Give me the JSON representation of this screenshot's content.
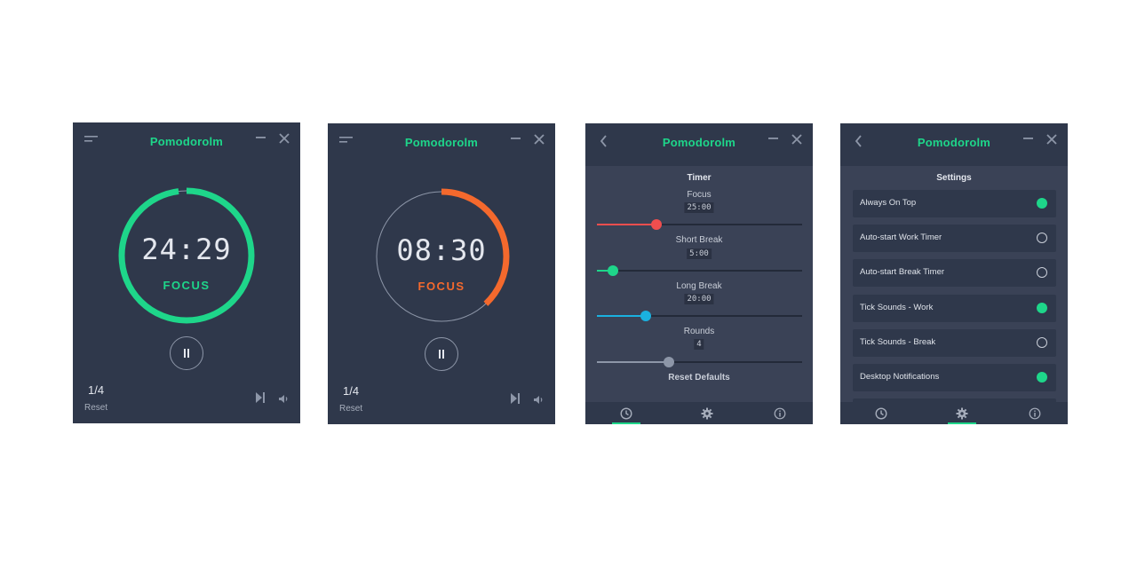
{
  "app": {
    "title": "Pomodorolm"
  },
  "colors": {
    "focus": "#1ed68a",
    "short_break": "#f4692d",
    "long_break": "#1ab1e0",
    "bg": "#2f384b",
    "panel": "#3a4256"
  },
  "timer_focus": {
    "time": "24:29",
    "mode": "FOCUS",
    "progress": 0.98,
    "round": "1/4",
    "reset_label": "Reset"
  },
  "timer_break": {
    "time": "08:30",
    "mode": "FOCUS",
    "progress": 0.38,
    "round": "1/4",
    "reset_label": "Reset"
  },
  "timer_settings": {
    "heading": "Timer",
    "sliders": [
      {
        "label": "Focus",
        "value": "25:00",
        "fraction": 0.29,
        "color": "#f04e4e"
      },
      {
        "label": "Short Break",
        "value": "5:00",
        "fraction": 0.08,
        "color": "#1ed68a"
      },
      {
        "label": "Long Break",
        "value": "20:00",
        "fraction": 0.24,
        "color": "#1ab1e0"
      },
      {
        "label": "Rounds",
        "value": "4",
        "fraction": 0.35,
        "color": "#8d96a8"
      }
    ],
    "reset_defaults": "Reset Defaults"
  },
  "settings": {
    "heading": "Settings",
    "options": [
      {
        "label": "Always On Top",
        "enabled": true
      },
      {
        "label": "Auto-start Work Timer",
        "enabled": false
      },
      {
        "label": "Auto-start Break Timer",
        "enabled": false
      },
      {
        "label": "Tick Sounds - Work",
        "enabled": true
      },
      {
        "label": "Tick Sounds - Break",
        "enabled": false
      },
      {
        "label": "Desktop Notifications",
        "enabled": true
      }
    ]
  },
  "icons": {
    "menu": "menu-lines-icon",
    "back": "chevron-left-icon",
    "minimize": "minimize-icon",
    "close": "close-icon",
    "pause": "pause-icon",
    "skip": "skip-forward-icon",
    "volume": "volume-icon",
    "timer_tab": "clock-icon",
    "settings_tab": "gear-icon",
    "about_tab": "info-icon"
  }
}
